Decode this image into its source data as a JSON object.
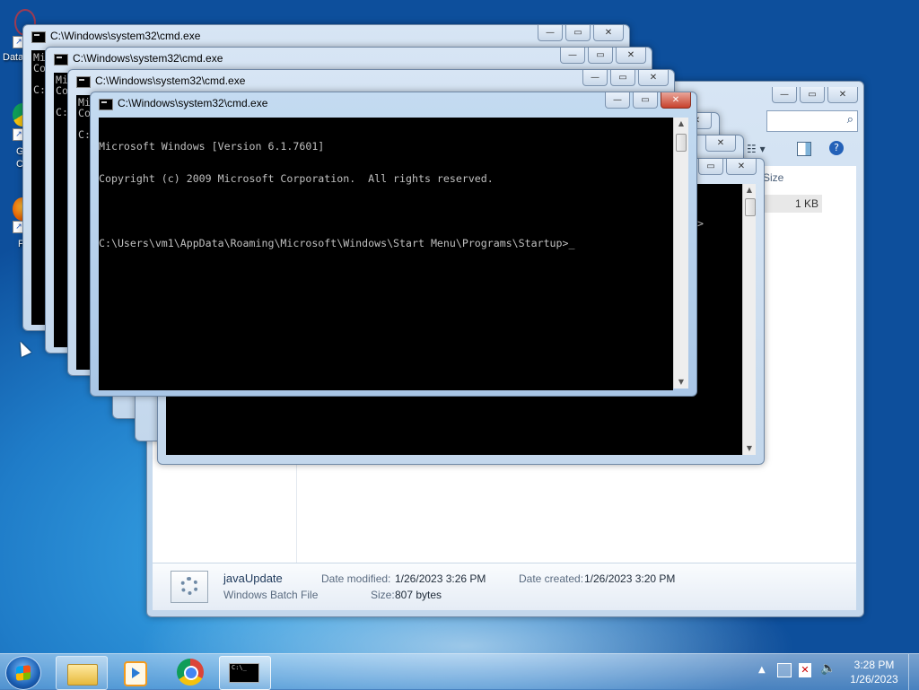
{
  "desktop": {
    "icons": [
      {
        "label": "Data",
        "icon": "shortcut-icon"
      },
      {
        "label": "G",
        "sublabel": "C",
        "icon": "chrome-shortcut-icon"
      },
      {
        "label": "F",
        "icon": "firefox-shortcut-icon"
      }
    ]
  },
  "cmd_windows": [
    {
      "title": "C:\\Windows\\system32\\cmd.exe",
      "peek": "Mi\nCo\n\nC:"
    },
    {
      "title": "C:\\Windows\\system32\\cmd.exe",
      "peek": "Mi\nCo\n\nC:"
    },
    {
      "title": "C:\\Windows\\system32\\cmd.exe",
      "peek": "Mi\nCo\n\nC:"
    },
    {
      "title": "C:\\Windows\\system32\\cmd.exe",
      "lines": [
        "Microsoft Windows [Version 6.1.7601]",
        "Copyright (c) 2009 Microsoft Corporation.  All rights reserved.",
        "",
        "C:\\Users\\vm1\\AppData\\Roaming\\Microsoft\\Windows\\Start Menu\\Programs\\Startup>_"
      ]
    }
  ],
  "explorer": {
    "column_size_header": "Size",
    "file_size": "1 KB",
    "details": {
      "name": "javaUpdate",
      "type": "Windows Batch File",
      "date_modified_label": "Date modified:",
      "date_modified": "1/26/2023 3:26 PM",
      "size_label": "Size:",
      "size": "807 bytes",
      "date_created_label": "Date created:",
      "date_created": "1/26/2023 3:20 PM"
    }
  },
  "bg_console_prompt_char": ">",
  "taskbar": {
    "time": "3:28 PM",
    "date": "1/26/2023",
    "pinned": [
      "explorer-icon",
      "media-player-icon",
      "chrome-icon",
      "cmd-icon"
    ]
  }
}
